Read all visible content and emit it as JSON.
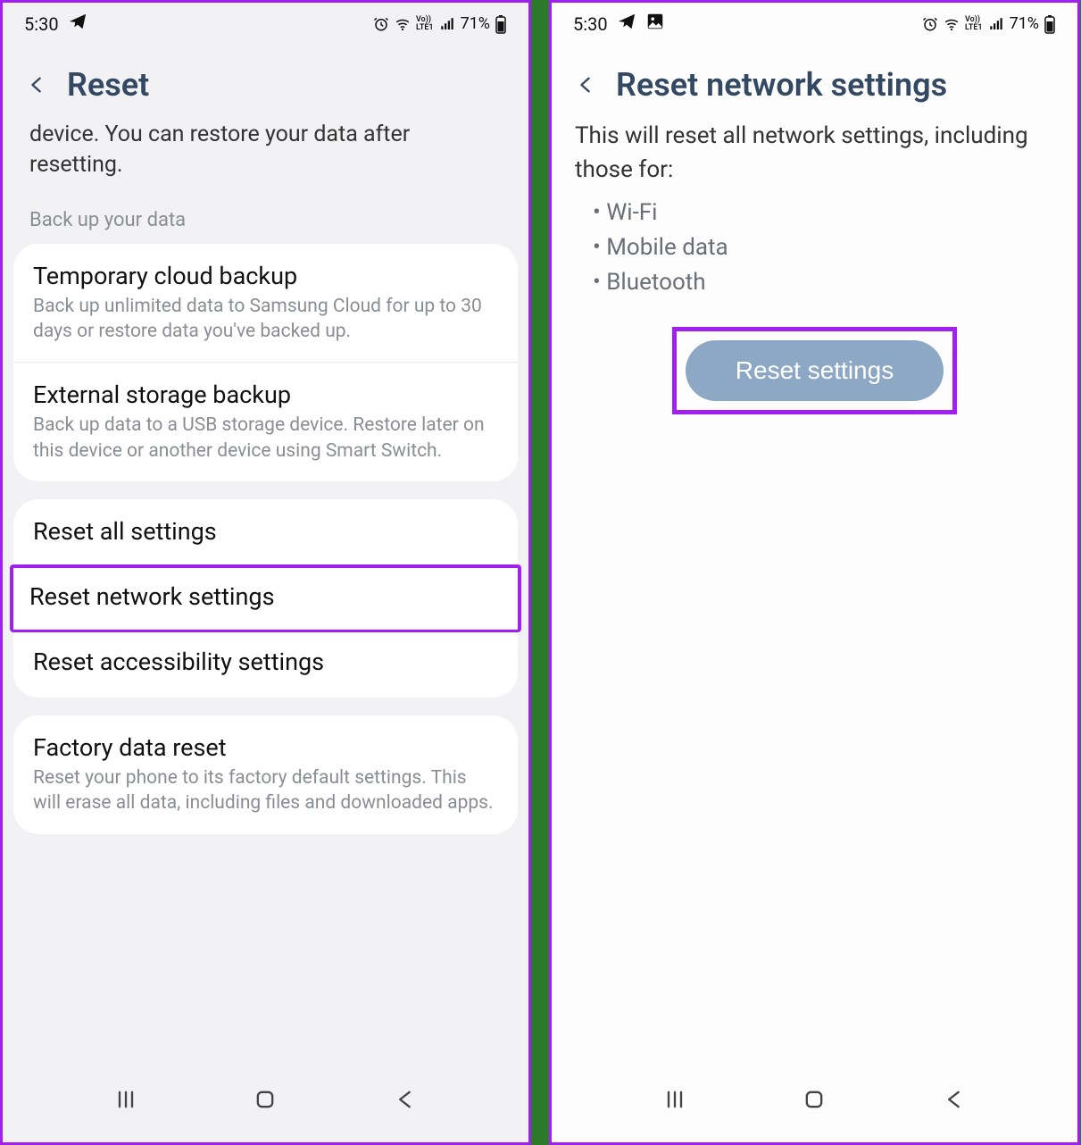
{
  "status": {
    "time": "5:30",
    "battery": "71%",
    "volte": "Vo))\nLTE1"
  },
  "left": {
    "title": "Reset",
    "partial_text": "device. You can restore your data after resetting.",
    "section_label": "Back up your data",
    "backup_items": [
      {
        "title": "Temporary cloud backup",
        "sub": "Back up unlimited data to Samsung Cloud for up to 30 days or restore data you've backed up."
      },
      {
        "title": "External storage backup",
        "sub": "Back up data to a USB storage device. Restore later on this device or another device using Smart Switch."
      }
    ],
    "reset_items": [
      {
        "title": "Reset all settings"
      },
      {
        "title": "Reset network settings"
      },
      {
        "title": "Reset accessibility settings"
      }
    ],
    "factory": {
      "title": "Factory data reset",
      "sub": "Reset your phone to its factory default settings. This will erase all data, including files and downloaded apps."
    }
  },
  "right": {
    "title": "Reset network settings",
    "body": "This will reset all network settings, including those for:",
    "bullets": [
      "Wi-Fi",
      "Mobile data",
      "Bluetooth"
    ],
    "button": "Reset settings"
  }
}
